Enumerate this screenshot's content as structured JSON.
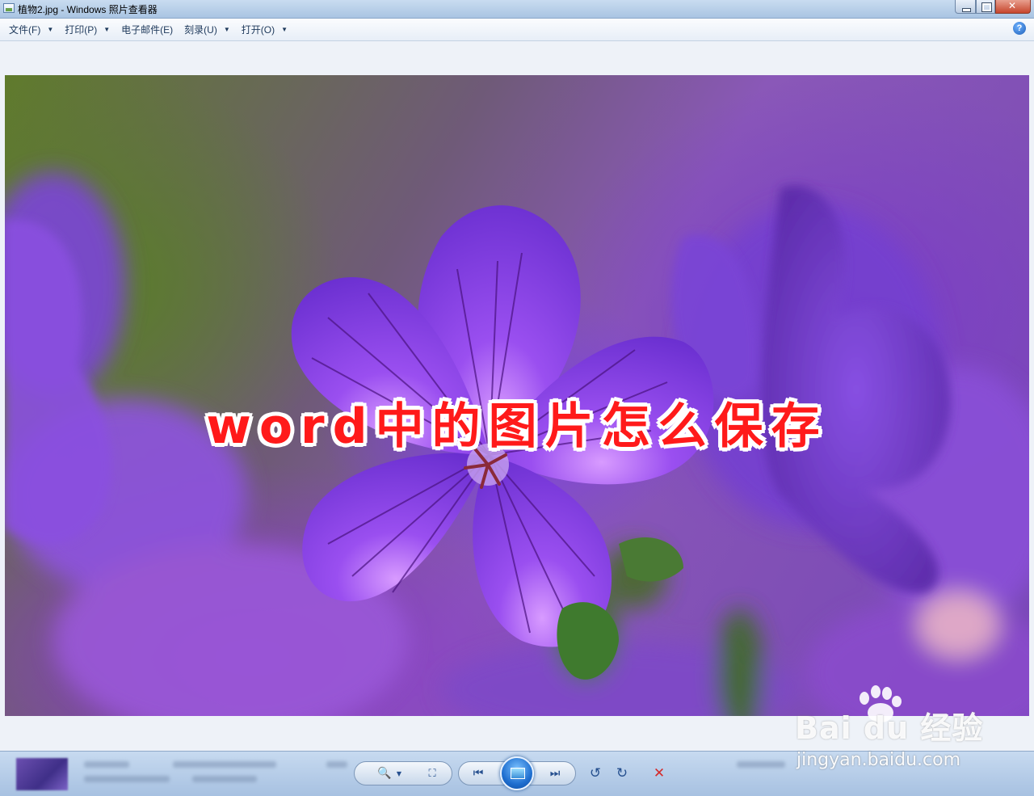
{
  "window": {
    "title": "植物2.jpg - Windows 照片查看器"
  },
  "menubar": {
    "items": [
      {
        "label": "文件(F)",
        "has_dropdown": true
      },
      {
        "label": "打印(P)",
        "has_dropdown": true
      },
      {
        "label": "电子邮件(E)",
        "has_dropdown": false
      },
      {
        "label": "刻录(U)",
        "has_dropdown": true
      },
      {
        "label": "打开(O)",
        "has_dropdown": true
      }
    ],
    "help_label": "?"
  },
  "image": {
    "overlay_text": "word中的图片怎么保存"
  },
  "watermark": {
    "logo": "Bai du 经验",
    "url": "jingyan.baidu.com"
  },
  "colors": {
    "overlay_text": "#ff1a1a",
    "overlay_outline": "#ffffff",
    "titlebar": "#b9d0ea",
    "slideshow_button": "#1f6fd0",
    "delete_icon": "#d42a2a"
  },
  "icons": {
    "zoom": "magnifier-plus-icon",
    "fit": "actual-size-icon",
    "previous": "skip-previous-icon",
    "slideshow": "slideshow-icon",
    "next": "skip-next-icon",
    "rotate_ccw": "rotate-counterclockwise-icon",
    "rotate_cw": "rotate-clockwise-icon",
    "delete": "delete-x-icon"
  }
}
